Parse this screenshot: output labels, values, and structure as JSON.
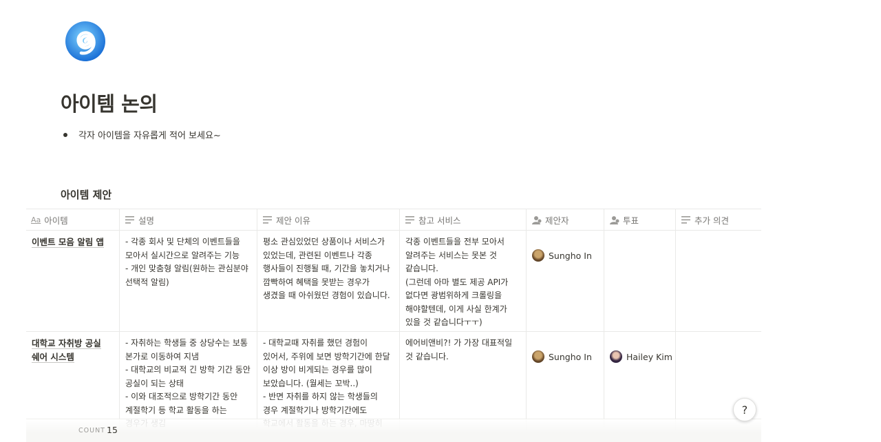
{
  "page": {
    "icon": "spiral-icon",
    "title": "아이템 논의",
    "bullet": "각자 아이템을 자유롭게 적어 보세요~"
  },
  "database": {
    "title": "아이템 제안",
    "columns": [
      {
        "label": "아이템",
        "icon": "title-aa-icon"
      },
      {
        "label": "설명",
        "icon": "text-lines-icon"
      },
      {
        "label": "제안 이유",
        "icon": "text-lines-icon"
      },
      {
        "label": "참고 서비스",
        "icon": "text-lines-icon"
      },
      {
        "label": "제안자",
        "icon": "person-icon"
      },
      {
        "label": "투표",
        "icon": "person-icon"
      },
      {
        "label": "추가 의견",
        "icon": "text-lines-icon"
      }
    ],
    "rows": [
      {
        "name": "이벤트 모음 알림 앱",
        "desc": "- 각종 회사 및 단체의 이벤트들을 모아서 실시간으로 알려주는 기능\n- 개인 맞춤형 알림(원하는 관심분야 선택적 알림)",
        "reason": "평소 관심있었던 상품이나 서비스가 있었는데, 관련된 이벤트나 각종 행사들이 진행될 때, 기간을 놓치거나 깜빡하여 혜택을 못받는 경우가 생겼을 때 아쉬웠던 경험이 있습니다.",
        "reference": "각종 이벤트들을 전부 모아서 알려주는 서비스는 못본 것 같습니다.\n(그런데 아마 별도 제공 API가 없다면 광범위하게 크롤링을 해야할텐데, 이게 사실 한계가 있을 것 같습니다ㅜㅜ)",
        "proposer": "Sungho In",
        "vote": "",
        "comment": ""
      },
      {
        "name": "대학교 자취방 공실 쉐어 시스템",
        "desc": "- 자취하는 학생들 중 상당수는 보통 본가로 이동하여 지냄\n- 대학교의 비교적 긴 방학 기간 동안 공실이 되는 상태\n- 이와 대조적으로 방학기간 동안 계절학기 등 학교 활동을 하는 경우가 생김",
        "reason": "- 대학교때 자취를 했던 경험이 있어서, 주위에 보면 방학기간에 한달 이상 방이 비게되는 경우를 많이 보았습니다. (월세는 꼬박..)\n- 반면 자취를 하지 않는 학생들의 경우 계절학기나 방학기간에도 학교에서 활동을 하는 경우, 마땅히 지낼 곳이 없",
        "reference": "에어비앤비?! 가 가장 대표적일 것 같습니다.",
        "proposer": "Sungho In",
        "vote": "Hailey Kim",
        "comment": ""
      }
    ],
    "count_label": "COUNT",
    "count_value": "15"
  },
  "help": {
    "label": "?",
    "icon": "question-icon"
  }
}
